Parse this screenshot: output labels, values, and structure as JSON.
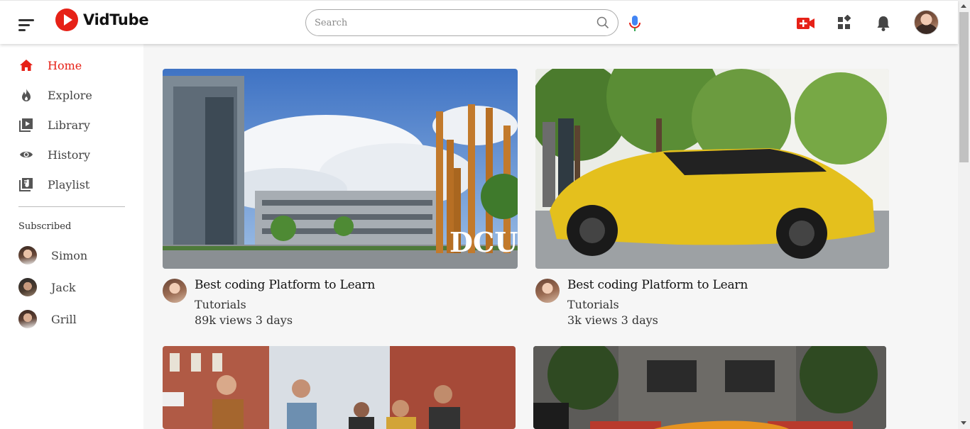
{
  "app": {
    "name": "VidTube"
  },
  "search": {
    "placeholder": "Search"
  },
  "sidebar": {
    "items": [
      {
        "label": "Home",
        "icon": "home-icon",
        "active": true
      },
      {
        "label": "Explore",
        "icon": "fire-icon"
      },
      {
        "label": "Library",
        "icon": "library-icon"
      },
      {
        "label": "History",
        "icon": "eye-icon"
      },
      {
        "label": "Playlist",
        "icon": "playlist-icon"
      }
    ],
    "subscribed_heading": "Subscribed",
    "subscriptions": [
      {
        "name": "Simon"
      },
      {
        "name": "Jack"
      },
      {
        "name": "Grill"
      }
    ]
  },
  "videos": [
    {
      "title": "Best coding Platform to Learn",
      "channel": "Tutorials",
      "meta": "89k views 3 days",
      "thumb_text": "DCU"
    },
    {
      "title": "Best coding Platform to Learn",
      "channel": "Tutorials",
      "meta": "3k views 3 days"
    },
    {
      "title": "",
      "channel": "",
      "meta": ""
    },
    {
      "title": "",
      "channel": "",
      "meta": ""
    }
  ],
  "colors": {
    "accent": "#e62117",
    "sidebar_bg": "#ffffff",
    "content_bg": "#f6f6f6"
  }
}
